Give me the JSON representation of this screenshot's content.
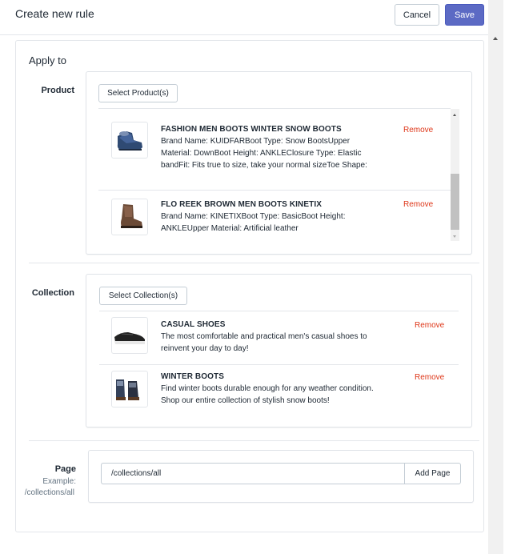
{
  "header": {
    "title": "Create new rule",
    "cancel_label": "Cancel",
    "save_label": "Save",
    "save_color": "#5c6ac4"
  },
  "apply_to": {
    "title": "Apply to"
  },
  "product": {
    "label": "Product",
    "select_label": "Select Product(s)",
    "items": [
      {
        "title": "FASHION MEN BOOTS WINTER SNOW BOOTS",
        "desc_lines": [
          "Brand Name: KUIDFARBoot Type: Snow BootsUpper",
          "Material: DownBoot Height: ANKLEClosure Type: Elastic",
          "bandFit: Fits true to size, take your normal sizeToe Shape:"
        ],
        "remove_label": "Remove",
        "icon": "snow-boot-image"
      },
      {
        "title": "FLO REEK BROWN MEN BOOTS KINETIX",
        "desc_lines": [
          "Brand Name: KINETIXBoot Type: BasicBoot Height:",
          "ANKLEUpper Material: Artificial leather"
        ],
        "remove_label": "Remove",
        "icon": "brown-boot-image"
      }
    ]
  },
  "collection": {
    "label": "Collection",
    "select_label": "Select Collection(s)",
    "items": [
      {
        "title": "CASUAL SHOES",
        "desc_lines": [
          "The most comfortable and practical men's casual shoes to",
          "reinvent your day to day!"
        ],
        "remove_label": "Remove",
        "icon": "casual-shoe-image"
      },
      {
        "title": "WINTER BOOTS",
        "desc_lines": [
          "Find winter boots durable enough for any weather condition.",
          "Shop our entire collection of stylish snow boots!"
        ],
        "remove_label": "Remove",
        "icon": "winter-boot-image"
      }
    ]
  },
  "page": {
    "label": "Page",
    "example_label": "Example:",
    "example_value": "/collections/all",
    "input_value": "/collections/all",
    "add_label": "Add Page"
  },
  "colors": {
    "remove": "#de3618",
    "border": "#dfe3e8",
    "text": "#212b36"
  }
}
